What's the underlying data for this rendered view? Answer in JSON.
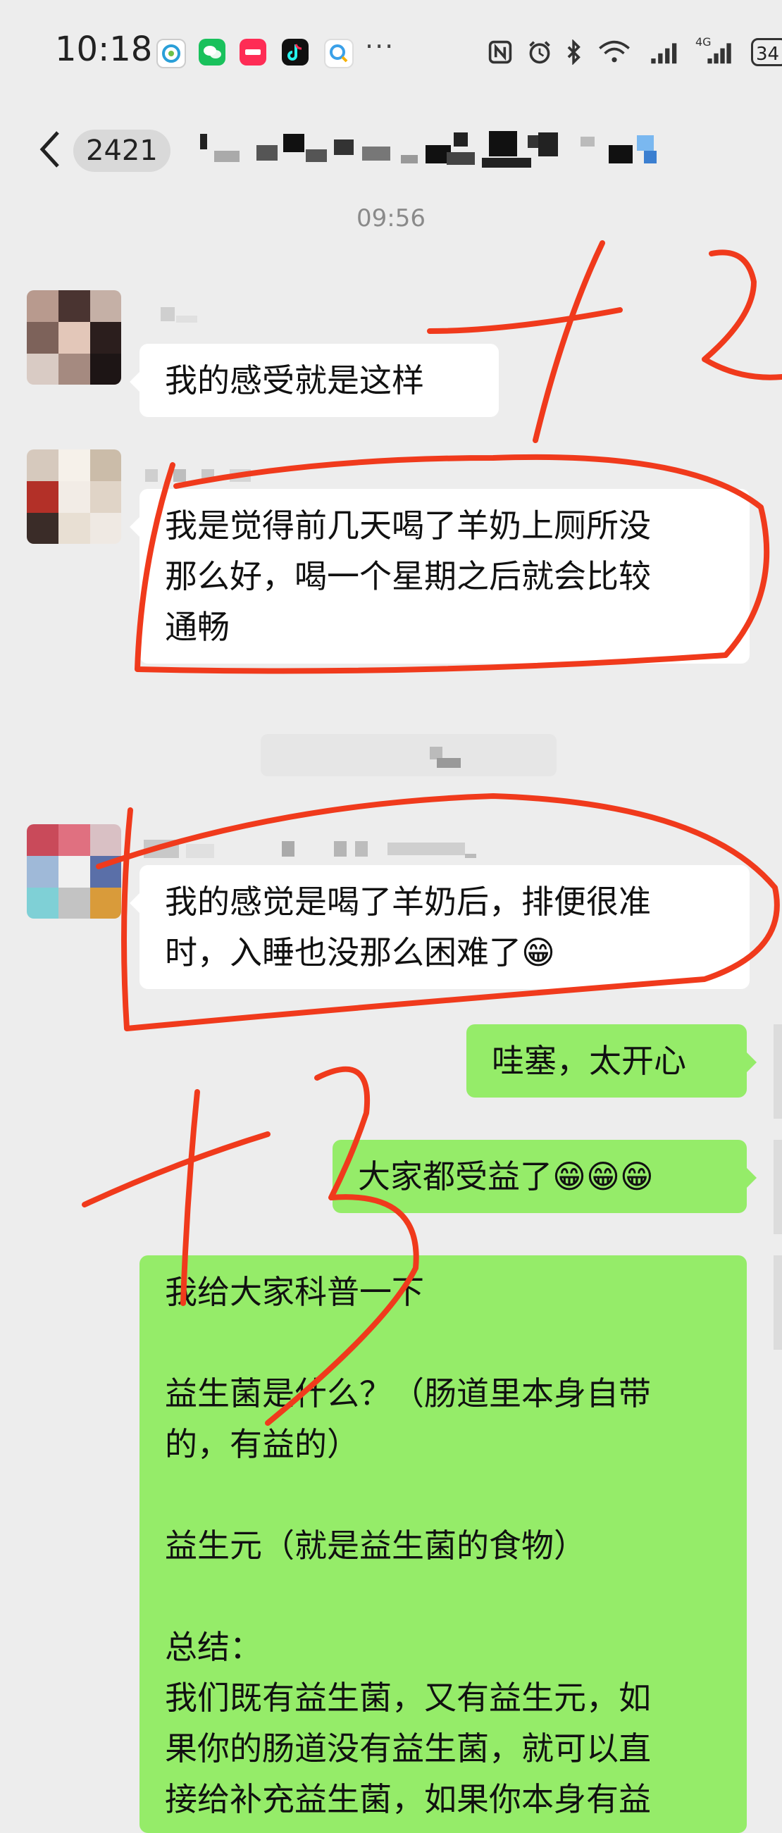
{
  "status_bar": {
    "time": "10:18",
    "more": "···",
    "battery": "34",
    "network": "4G"
  },
  "nav": {
    "unread_count": "2421",
    "back_icon": "chevron-left-icon"
  },
  "timestamp": "09:56",
  "messages": [
    {
      "side": "in",
      "text": "我的感受就是这样"
    },
    {
      "side": "in",
      "text": "我是觉得前几天喝了羊奶上厕所没\n那么好，喝一个星期之后就会比较\n通畅"
    },
    {
      "side": "in",
      "text": "我的感觉是喝了羊奶后，排便很准\n时，入睡也没那么困难了😁"
    },
    {
      "side": "out",
      "text": "哇塞，太开心"
    },
    {
      "side": "out",
      "text": "大家都受益了😁😁😁"
    },
    {
      "side": "out",
      "text": "我给大家科普一下\n\n益生菌是什么？（肠道里本身自带\n的，有益的）\n\n益生元（就是益生菌的食物）\n\n总结：\n我们既有益生菌，又有益生元，如\n果你的肠道没有益生菌，就可以直\n接给补充益生菌，如果你本身有益\n生菌，但是比较弱，我们就可以给"
    }
  ],
  "annotations": {
    "ink_color": "#f03a1c",
    "marks": [
      "+2",
      "+3"
    ]
  }
}
